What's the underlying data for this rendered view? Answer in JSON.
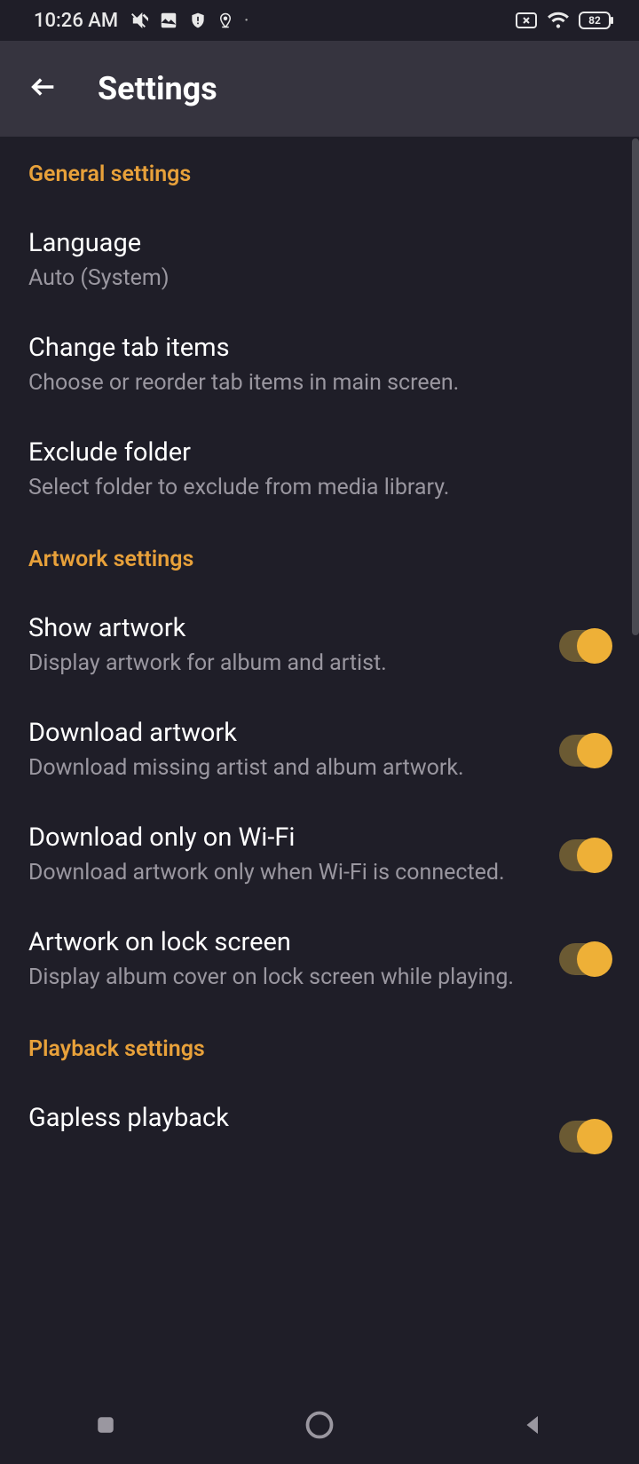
{
  "status": {
    "time": "10:26 AM",
    "battery": "82"
  },
  "header": {
    "title": "Settings"
  },
  "sections": {
    "general": {
      "header": "General settings",
      "language": {
        "title": "Language",
        "subtitle": "Auto (System)"
      },
      "tabs": {
        "title": "Change tab items",
        "subtitle": "Choose or reorder tab items in main screen."
      },
      "exclude": {
        "title": "Exclude folder",
        "subtitle": "Select folder to exclude from media library."
      }
    },
    "artwork": {
      "header": "Artwork settings",
      "show": {
        "title": "Show artwork",
        "subtitle": "Display artwork for album and artist."
      },
      "download": {
        "title": "Download artwork",
        "subtitle": "Download missing artist and album artwork."
      },
      "wifi": {
        "title": "Download only on Wi-Fi",
        "subtitle": "Download artwork only when Wi-Fi is connected."
      },
      "lockscreen": {
        "title": "Artwork on lock screen",
        "subtitle": "Display album cover on lock screen while playing."
      }
    },
    "playback": {
      "header": "Playback settings",
      "gapless": {
        "title": "Gapless playback"
      }
    }
  }
}
